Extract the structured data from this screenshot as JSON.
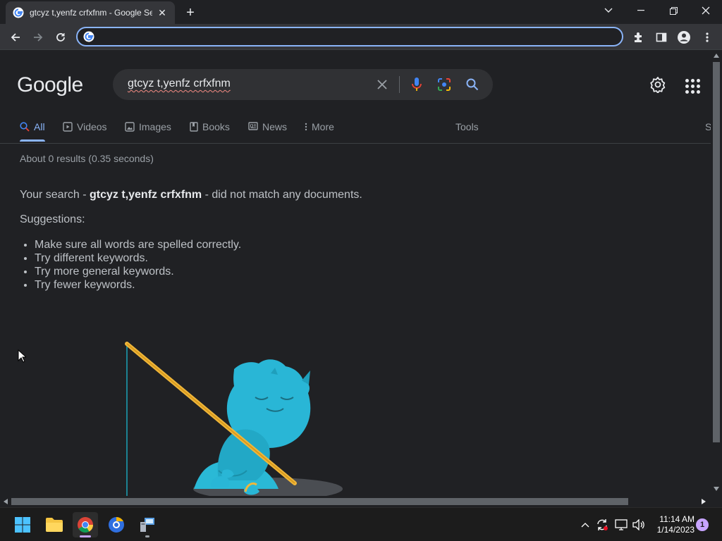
{
  "browser": {
    "tab_title": "gtcyz t,yenfz crfxfnm - Google Se",
    "tab_close": "✕",
    "new_tab": "+",
    "omnibox_value": ""
  },
  "google": {
    "logo": "Google",
    "query": "gtcyz t,yenfz crfxfnm",
    "tabs": [
      {
        "label": "All",
        "icon": "search-icon"
      },
      {
        "label": "Videos",
        "icon": "video-icon"
      },
      {
        "label": "Images",
        "icon": "image-icon"
      },
      {
        "label": "Books",
        "icon": "book-icon"
      },
      {
        "label": "News",
        "icon": "news-icon"
      },
      {
        "label": "More",
        "icon": "more-icon"
      }
    ],
    "tools": "Tools",
    "safesearch_partial": "S",
    "stats": "About 0 results (0.35 seconds)",
    "message_prefix": "Your search - ",
    "message_query": "gtcyz t,yenfz crfxfnm",
    "message_suffix": " - did not match any documents.",
    "suggestions_title": "Suggestions:",
    "suggestions": [
      "Make sure all words are spelled correctly.",
      "Try different keywords.",
      "Try more general keywords.",
      "Try fewer keywords."
    ]
  },
  "taskbar": {
    "time": "11:14 AM",
    "date": "1/14/2023",
    "notification_count": "1"
  },
  "colors": {
    "accent": "#8ab4f8",
    "background": "#202124",
    "monster": "#29b6d6"
  }
}
